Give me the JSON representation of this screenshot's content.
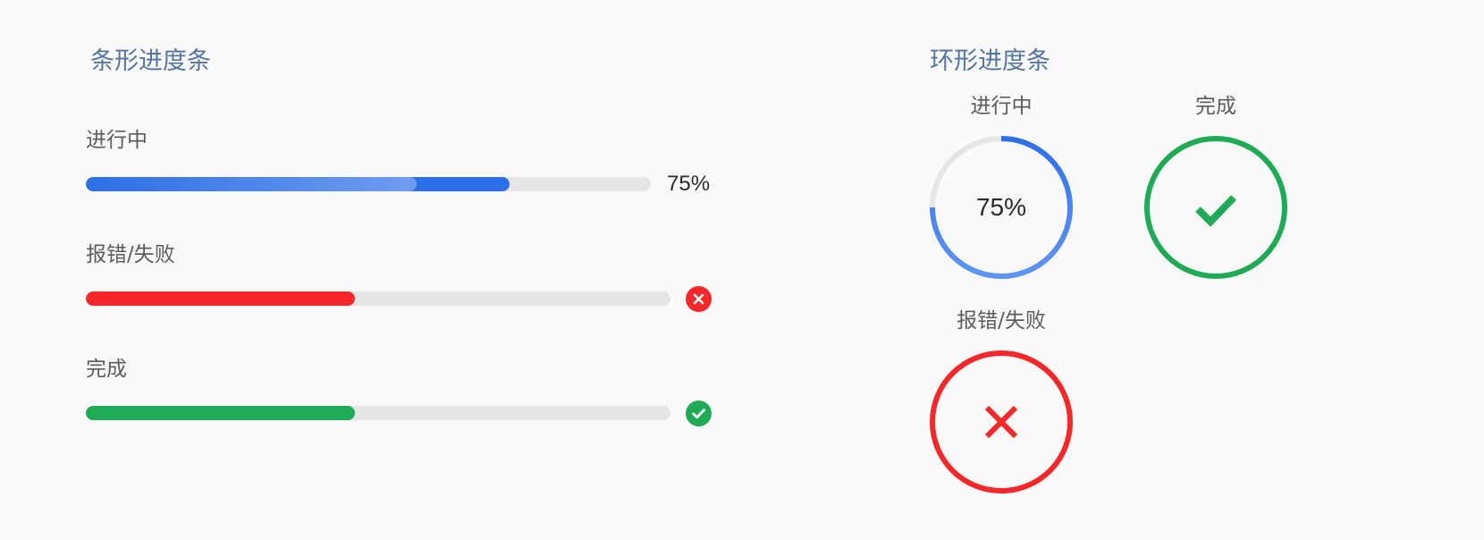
{
  "bar_section": {
    "title": "条形进度条",
    "items": [
      {
        "label": "进行中",
        "status": "in-progress",
        "progress_percent": 75,
        "progress_text": "75%",
        "fill_ratio": 0.75,
        "color": "#2d6fe6"
      },
      {
        "label": "报错/失败",
        "status": "error",
        "fill_ratio": 0.46,
        "color": "#f5272a",
        "icon": "close-icon"
      },
      {
        "label": "完成",
        "status": "complete",
        "fill_ratio": 0.46,
        "color": "#1faa55",
        "icon": "check-icon"
      }
    ]
  },
  "ring_section": {
    "title": "环形进度条",
    "items": [
      {
        "label": "进行中",
        "status": "in-progress",
        "progress_percent": 75,
        "progress_text": "75%",
        "color": "#2d6fe6"
      },
      {
        "label": "完成",
        "status": "complete",
        "color": "#1faa55",
        "icon": "check-icon"
      },
      {
        "label": "报错/失败",
        "status": "error",
        "color": "#f5272a",
        "icon": "close-icon"
      }
    ]
  },
  "colors": {
    "title": "#5474a4",
    "track": "#e5e5e5",
    "blue": "#2d6fe6",
    "red": "#f5272a",
    "green": "#1faa55"
  }
}
